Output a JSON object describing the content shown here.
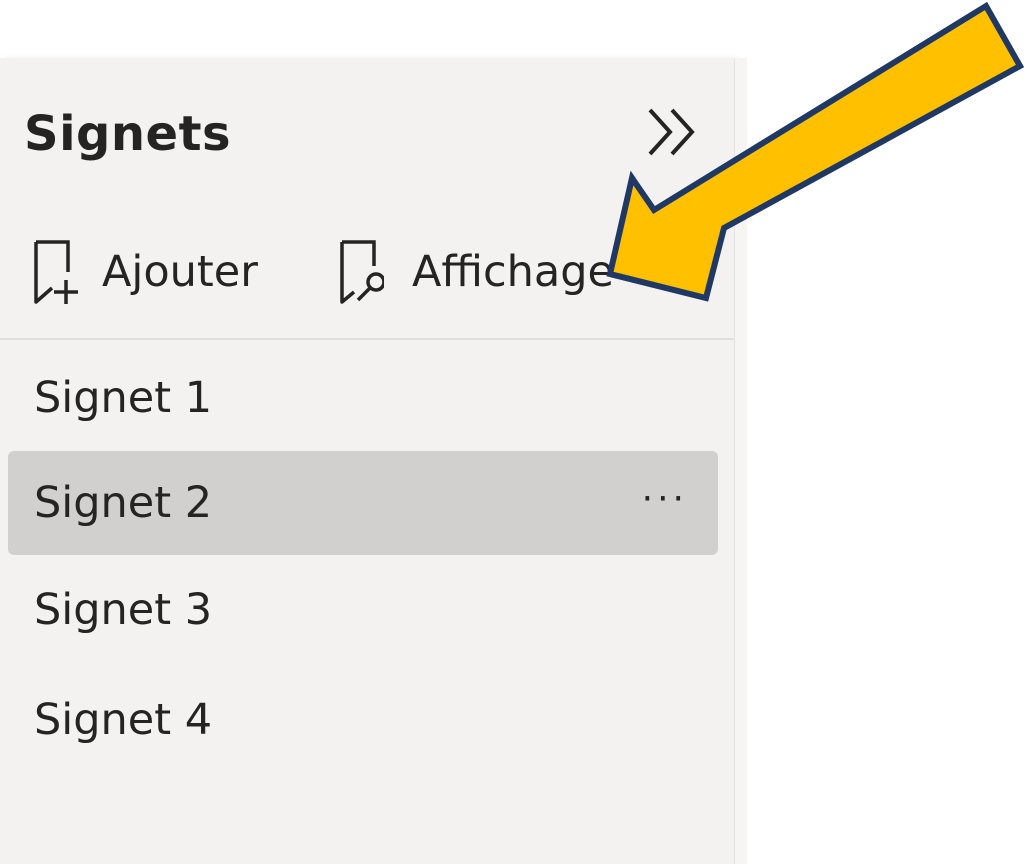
{
  "panel": {
    "title": "Signets",
    "collapse_icon": "double-chevron-right-icon"
  },
  "toolbar": {
    "add_label": "Ajouter",
    "add_icon": "bookmark-add-icon",
    "view_label": "Affichage",
    "view_icon": "bookmark-search-icon"
  },
  "bookmarks": [
    {
      "label": "Signet 1",
      "selected": false
    },
    {
      "label": "Signet 2",
      "selected": true,
      "more_label": "···"
    },
    {
      "label": "Signet 3",
      "selected": false
    },
    {
      "label": "Signet 4",
      "selected": false
    }
  ],
  "annotation": {
    "type": "arrow",
    "fill_color": "#ffc000",
    "stroke_color": "#1f3864"
  },
  "colors": {
    "panel_bg": "#f3f2f1",
    "selected_bg": "#d2d0ce",
    "text": "#252423"
  }
}
